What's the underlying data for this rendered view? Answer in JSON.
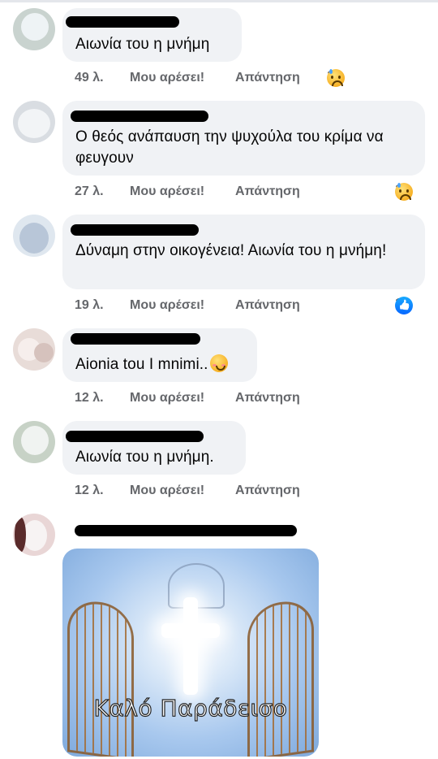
{
  "comments": [
    {
      "text": "Αιωνία του η μνήμη",
      "time": "49 λ.",
      "like": "Μου αρέσει!",
      "reply": "Απάντηση",
      "reaction_count": "1",
      "reaction": "sad-icon"
    },
    {
      "text": "Ο θεός ανάπαυση την ψυχούλα του κρίμα να φευγουν",
      "time": "27 λ.",
      "like": "Μου αρέσει!",
      "reply": "Απάντηση",
      "reaction_count": "1",
      "reaction": "sad-icon"
    },
    {
      "text": "Δύναμη στην οικογένεια! Αιωνία του η μνήμη!",
      "time": "19 λ.",
      "like": "Μου αρέσει!",
      "reply": "Απάντηση",
      "reaction_count": "1",
      "reaction": "like-icon"
    },
    {
      "text": "Aionia tou I mnimi..",
      "time": "12 λ.",
      "like": "Μου αρέσει!",
      "reply": "Απάντηση",
      "reaction_count": "",
      "reaction": ""
    },
    {
      "text": "Αιωνία του η μνήμη.",
      "time": "12 λ.",
      "like": "Μου αρέσει!",
      "reply": "Απάντηση",
      "reaction_count": "",
      "reaction": ""
    }
  ],
  "image_comment": {
    "caption": "Καλό Παράδεισο"
  },
  "colors": {
    "bubble": "#f0f2f5",
    "meta": "#65676b",
    "like_blue": "#0866ff"
  }
}
